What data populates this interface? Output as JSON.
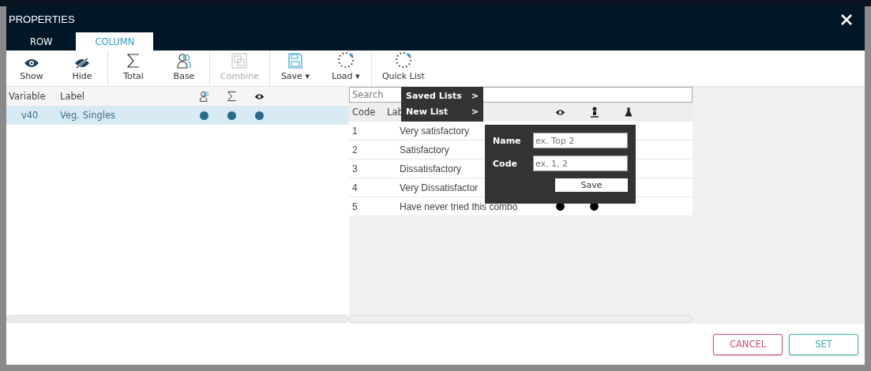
{
  "window": {
    "title": "PROPERTIES"
  },
  "tabs": [
    {
      "label": "ROW",
      "selected": false
    },
    {
      "label": "COLUMN",
      "selected": true
    }
  ],
  "toolbar": [
    {
      "kind": "eye",
      "label": "Show",
      "disabled": false
    },
    {
      "kind": "eye-off",
      "label": "Hide",
      "disabled": false
    },
    {
      "kind": "sigma",
      "label": "Total",
      "disabled": false
    },
    {
      "kind": "person",
      "label": "Base",
      "disabled": false
    },
    {
      "kind": "combine",
      "label": "Combine",
      "disabled": true
    },
    {
      "kind": "save",
      "label": "Save ▾",
      "disabled": false
    },
    {
      "kind": "load",
      "label": "Load ▾",
      "disabled": false
    },
    {
      "kind": "load",
      "label": "Quick List",
      "disabled": false
    }
  ],
  "variables": {
    "columns": [
      "Variable",
      "Label"
    ],
    "rows": [
      {
        "variable": "v40",
        "label": "Veg. Singles",
        "selected": true,
        "base": true,
        "total": true,
        "show": true
      }
    ]
  },
  "codes": {
    "search": {
      "placeholder": "Search"
    },
    "columns": [
      "Code",
      "Lab"
    ],
    "rows": [
      {
        "code": "1",
        "label": "Very satisfactory"
      },
      {
        "code": "2",
        "label": "Satisfactory"
      },
      {
        "code": "3",
        "label": "Dissatisfactory"
      },
      {
        "code": "4",
        "label": "Very Dissatisfactor"
      },
      {
        "code": "5",
        "label": "Have never tried this combo",
        "show": true,
        "base": true,
        "test": false
      }
    ]
  },
  "menu": [
    {
      "label": "Saved Lists",
      "arrow": ">"
    },
    {
      "label": "New List",
      "arrow": ">"
    }
  ],
  "new_list": {
    "name_label": "Name",
    "name_placeholder": "ex. Top 2",
    "code_label": "Code",
    "code_placeholder": "ex. 1, 2",
    "save": "Save"
  },
  "buttons": [
    {
      "kind": "cancel",
      "label": "CANCEL"
    },
    {
      "kind": "set",
      "label": "SET"
    }
  ]
}
